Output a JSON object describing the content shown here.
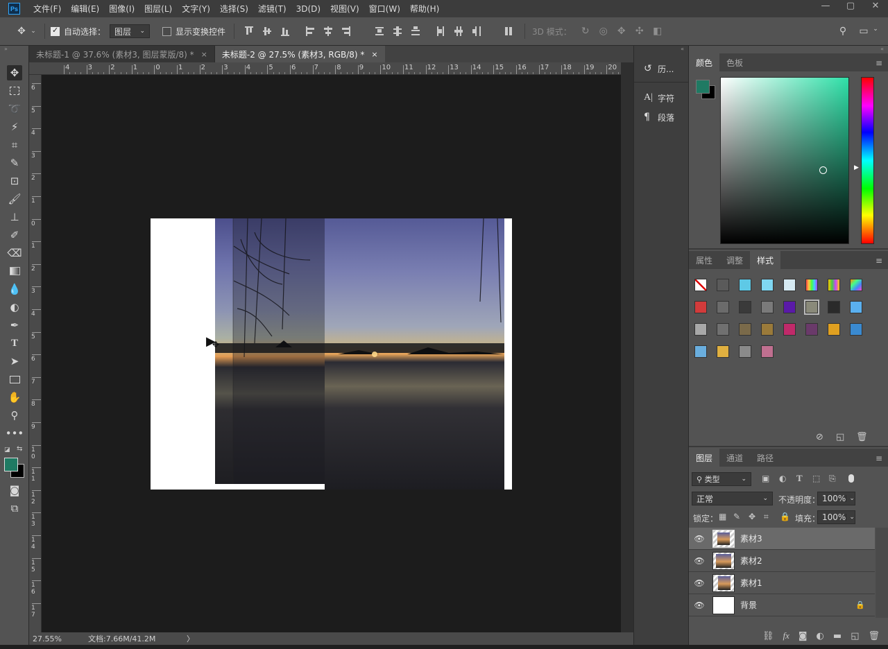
{
  "app": {
    "logo": "Ps"
  },
  "menu": [
    "文件(F)",
    "编辑(E)",
    "图像(I)",
    "图层(L)",
    "文字(Y)",
    "选择(S)",
    "滤镜(T)",
    "3D(D)",
    "视图(V)",
    "窗口(W)",
    "帮助(H)"
  ],
  "window_controls": {
    "minimize": "—",
    "maximize": "▢",
    "close": "✕"
  },
  "options": {
    "auto_select_label": "自动选择：",
    "auto_select_checked": true,
    "auto_select_target": "图层",
    "show_transform_label": "显示变换控件",
    "show_transform_checked": false,
    "mode_3d_label": "3D 模式："
  },
  "tabs": [
    {
      "label": "未标题-1 @ 37.6% (素材3, 图层蒙版/8) *",
      "close": "×",
      "active": false
    },
    {
      "label": "未标题-2 @ 27.5% (素材3, RGB/8) *",
      "close": "×",
      "active": true
    }
  ],
  "ruler_top": [
    "4",
    "3",
    "2",
    "1",
    "0",
    "1",
    "2",
    "3",
    "4",
    "5",
    "6",
    "7",
    "8",
    "9",
    "10",
    "11",
    "12",
    "13",
    "14",
    "15",
    "16",
    "17",
    "18",
    "19",
    "20"
  ],
  "ruler_left": [
    "6",
    "5",
    "4",
    "3",
    "2",
    "1",
    "0",
    "1",
    "2",
    "3",
    "4",
    "5",
    "6",
    "7",
    "8",
    "9",
    "10",
    "11",
    "12",
    "13",
    "14",
    "15",
    "16",
    "17"
  ],
  "status": {
    "zoom": "27.55%",
    "doc": "文档:7.66M/41.2M",
    "arrow": "〉"
  },
  "mini_panels": [
    {
      "icon": "history-icon",
      "label": "历..."
    },
    {
      "icon": "character-icon",
      "label": "字符"
    },
    {
      "icon": "paragraph-icon",
      "label": "段落"
    }
  ],
  "color_panel": {
    "tabs": [
      "颜色",
      "色板"
    ],
    "foreground": "#1f7a63",
    "background": "#000000",
    "hue": "#2fe0a8"
  },
  "styles_panel": {
    "tabs": [
      "属性",
      "调整",
      "样式"
    ],
    "swatches": [
      "none",
      "#5a5a5a",
      "#5ec9e6",
      "#7fd7f2",
      "#d6eaf2",
      "rainbow1",
      "rainbow2",
      "rainbow3",
      "#d23b3b",
      "#6b6b6b",
      "#3a3a3a",
      "#7a7a7a",
      "#5a1aa8",
      "#8a8a7a",
      "#2a2a2a",
      "#5ab0f0",
      "#a8a8a8",
      "#707070",
      "#7a6a4a",
      "#9a7a3a",
      "#c02a6a",
      "#6a3a6a",
      "#e0a020",
      "#3a8ad0",
      "#6aaede",
      "#e0b040",
      "#8a8a8a",
      "#c07090"
    ]
  },
  "layers_panel": {
    "tabs": [
      "图层",
      "通道",
      "路径"
    ],
    "filter": "类型",
    "blend_mode": "正常",
    "opacity_label": "不透明度：",
    "opacity": "100%",
    "lock_label": "锁定：",
    "fill_label": "填充：",
    "fill": "100%",
    "layers": [
      {
        "name": "素材3",
        "selected": true,
        "locked": false
      },
      {
        "name": "素材2",
        "selected": false,
        "locked": false
      },
      {
        "name": "素材1",
        "selected": false,
        "locked": false
      },
      {
        "name": "背景",
        "selected": false,
        "locked": true
      }
    ]
  }
}
